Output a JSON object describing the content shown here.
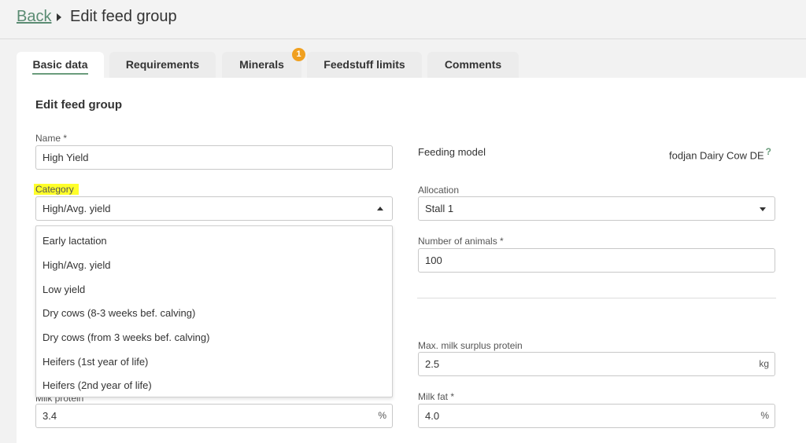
{
  "header": {
    "back_label": "Back",
    "title": "Edit feed group"
  },
  "tabs": [
    {
      "label": "Basic data"
    },
    {
      "label": "Requirements"
    },
    {
      "label": "Minerals",
      "badge": "1"
    },
    {
      "label": "Feedstuff limits"
    },
    {
      "label": "Comments"
    }
  ],
  "form": {
    "section_title": "Edit feed group",
    "name": {
      "label": "Name *",
      "value": "High Yield"
    },
    "feeding_model": {
      "label": "Feeding model",
      "value": "fodjan Dairy Cow DE",
      "help": "?"
    },
    "category": {
      "label": "Category",
      "value": "High/Avg. yield"
    },
    "allocation": {
      "label": "Allocation",
      "value": "Stall 1"
    },
    "number_of_animals": {
      "label": "Number of animals *",
      "value": "100"
    },
    "max_milk_surplus_protein": {
      "label": "Max. milk surplus protein",
      "value": "2.5",
      "unit": "kg"
    },
    "milk_protein": {
      "label": "Milk protein",
      "value": "3.4",
      "unit": "%"
    },
    "milk_fat": {
      "label": "Milk fat *",
      "value": "4.0",
      "unit": "%"
    }
  },
  "category_options": [
    "Early lactation",
    "High/Avg. yield",
    "Low yield",
    "Dry cows (8-3 weeks bef. calving)",
    "Dry cows (from 3 weeks bef. calving)",
    "Heifers (1st year of life)",
    "Heifers (2nd year of life)"
  ],
  "colors": {
    "accent": "#6a9c7c",
    "badge": "#f0a020",
    "highlight": "#ffff2a"
  }
}
